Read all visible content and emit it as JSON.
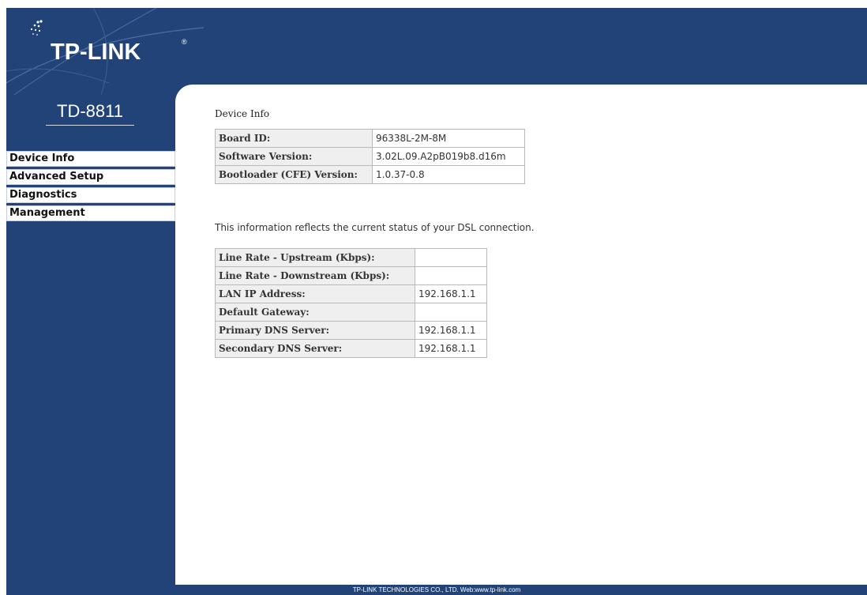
{
  "brand": {
    "logo": "TP-LINK",
    "registered_mark": "®",
    "model": "TD-8811"
  },
  "sidebar": {
    "items": [
      {
        "label": "Device Info"
      },
      {
        "label": "Advanced Setup"
      },
      {
        "label": "Diagnostics"
      },
      {
        "label": "Management"
      }
    ]
  },
  "main": {
    "title": "Device Info",
    "device_table": [
      {
        "label": "Board ID:",
        "value": "96338L-2M-8M"
      },
      {
        "label": "Software Version:",
        "value": "3.02L.09.A2pB019b8.d16m"
      },
      {
        "label": "Bootloader (CFE) Version:",
        "value": "1.0.37-0.8"
      }
    ],
    "status_text": "This information reflects the current status of your DSL connection.",
    "status_table": [
      {
        "label": "Line Rate - Upstream (Kbps):",
        "value": ""
      },
      {
        "label": "Line Rate - Downstream (Kbps):",
        "value": ""
      },
      {
        "label": "LAN IP Address:",
        "value": "192.168.1.1"
      },
      {
        "label": "Default Gateway:",
        "value": ""
      },
      {
        "label": "Primary DNS Server:",
        "value": "192.168.1.1"
      },
      {
        "label": "Secondary DNS Server:",
        "value": "192.168.1.1"
      }
    ]
  },
  "footer": {
    "text": "TP-LINK TECHNOLOGIES CO., LTD. Web:www.tp-link.com"
  },
  "colors": {
    "background_blue": "#214378",
    "label_cell_bg": "#efefef",
    "content_bg": "#ffffff"
  }
}
